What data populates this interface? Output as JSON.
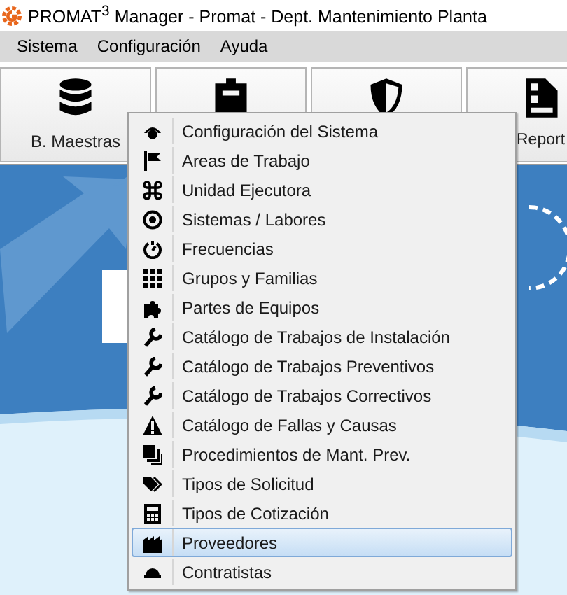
{
  "window": {
    "title": "PROMAT$^{3}$ Manager - Promat - Dept. Mantenimiento Planta"
  },
  "menubar": [
    {
      "label": "Sistema",
      "selected": false
    },
    {
      "label": "Configuración",
      "selected": false
    },
    {
      "label": "Ayuda",
      "selected": false
    }
  ],
  "toolbar": [
    {
      "label": "B. Maestras"
    },
    {
      "label": "Report"
    }
  ],
  "dropdown": [
    {
      "label": "Configuración del Sistema",
      "selected": false
    },
    {
      "label": "Areas de Trabajo",
      "selected": false
    },
    {
      "label": "Unidad Ejecutora",
      "selected": false
    },
    {
      "label": "Sistemas / Labores",
      "selected": false
    },
    {
      "label": "Frecuencias",
      "selected": false
    },
    {
      "label": "Grupos y Familias",
      "selected": false
    },
    {
      "label": "Partes de Equipos",
      "selected": false
    },
    {
      "label": "Catálogo de Trabajos de Instalación",
      "selected": false
    },
    {
      "label": "Catálogo de Trabajos Preventivos",
      "selected": false
    },
    {
      "label": "Catálogo de Trabajos Correctivos",
      "selected": false
    },
    {
      "label": "Catálogo de Fallas y Causas",
      "selected": false
    },
    {
      "label": "Procedimientos de Mant. Prev.",
      "selected": false
    },
    {
      "label": "Tipos de Solicitud",
      "selected": false
    },
    {
      "label": "Tipos de Cotización",
      "selected": false
    },
    {
      "label": "Proveedores",
      "selected": true
    },
    {
      "label": "Contratistas",
      "selected": false
    }
  ]
}
